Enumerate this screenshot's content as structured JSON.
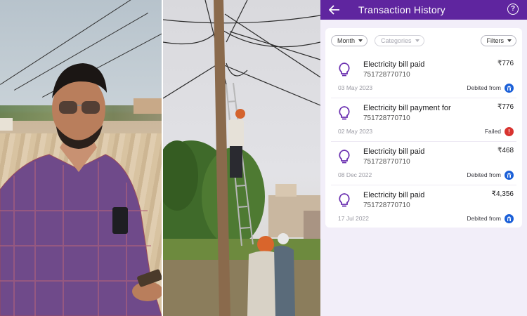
{
  "app": {
    "title": "Transaction History",
    "help_label": "?",
    "accent": "#5f259f",
    "filters": [
      {
        "label": "Month"
      },
      {
        "label": "Categories"
      },
      {
        "label": "Filters"
      }
    ],
    "transactions": [
      {
        "title": "Electricity bill paid",
        "account": "751728770710",
        "amount": "₹776",
        "date": "03 May 2023",
        "status": "Debited from",
        "status_icon": "bank-icon",
        "status_color": "#1a5fd8"
      },
      {
        "title": "Electricity bill payment for",
        "account": "751728770710",
        "amount": "₹776",
        "date": "02 May 2023",
        "status": "Failed",
        "status_icon": "exclamation-icon",
        "status_color": "#d8332f"
      },
      {
        "title": "Electricity bill paid",
        "account": "751728770710",
        "amount": "₹468",
        "date": "08 Dec 2022",
        "status": "Debited from",
        "status_icon": "bank-icon",
        "status_color": "#1a5fd8"
      },
      {
        "title": "Electricity bill paid",
        "account": "751728770710",
        "amount": "₹4,356",
        "date": "17 Jul 2022",
        "status": "Debited from",
        "status_icon": "bank-icon",
        "status_color": "#1a5fd8"
      }
    ]
  }
}
